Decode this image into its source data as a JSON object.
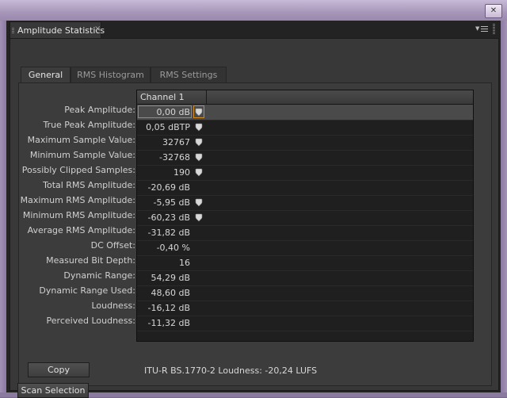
{
  "window": {
    "close_glyph": "✕"
  },
  "panel": {
    "title": "Amplitude Statistics",
    "tab_close": "×",
    "menu_icon": "panel-menu-icon"
  },
  "tabs": [
    {
      "label": "General",
      "active": true
    },
    {
      "label": "RMS Histogram",
      "active": false
    },
    {
      "label": "RMS Settings",
      "active": false
    }
  ],
  "table": {
    "column": "Channel 1",
    "rows": [
      {
        "label": "Peak Amplitude:",
        "value": "0,00 dB",
        "pin": true,
        "selected": true
      },
      {
        "label": "True Peak Amplitude:",
        "value": "0,05 dBTP",
        "pin": true
      },
      {
        "label": "Maximum Sample Value:",
        "value": "32767",
        "pin": true
      },
      {
        "label": "Minimum Sample Value:",
        "value": "-32768",
        "pin": true
      },
      {
        "label": "Possibly Clipped Samples:",
        "value": "190",
        "pin": true
      },
      {
        "label": "Total RMS Amplitude:",
        "value": "-20,69 dB",
        "pin": false
      },
      {
        "label": "Maximum RMS Amplitude:",
        "value": "-5,95 dB",
        "pin": true
      },
      {
        "label": "Minimum RMS Amplitude:",
        "value": "-60,23 dB",
        "pin": true
      },
      {
        "label": "Average RMS Amplitude:",
        "value": "-31,82 dB",
        "pin": false
      },
      {
        "label": "DC Offset:",
        "value": "-0,40 %",
        "pin": false
      },
      {
        "label": "Measured Bit Depth:",
        "value": "16",
        "pin": false
      },
      {
        "label": "Dynamic Range:",
        "value": "54,29 dB",
        "pin": false
      },
      {
        "label": "Dynamic Range Used:",
        "value": "48,60 dB",
        "pin": false
      },
      {
        "label": "Loudness:",
        "value": "-16,12 dB",
        "pin": false
      },
      {
        "label": "Perceived Loudness:",
        "value": "-11,32 dB",
        "pin": false
      }
    ]
  },
  "copy_label": "Copy",
  "itu_text": "ITU-R BS.1770-2 Loudness:  -20,24 LUFS",
  "scan_label": "Scan Selection",
  "colors": {
    "accent": "#d08a20",
    "panel_bg": "#383838"
  }
}
